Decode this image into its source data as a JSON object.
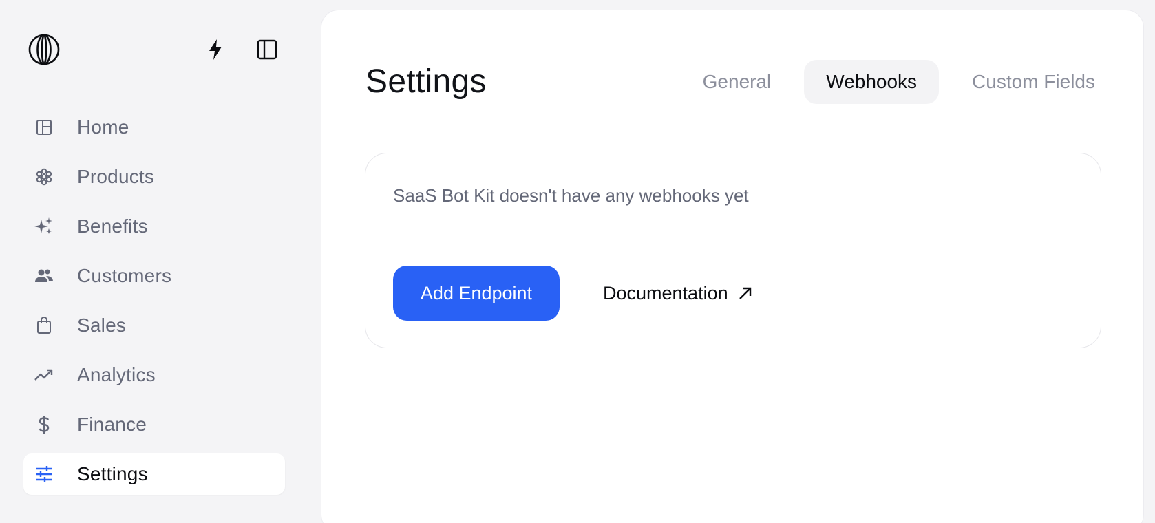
{
  "sidebar": {
    "logo_icon": "polar-logo-icon",
    "top_actions": [
      {
        "icon": "bolt-icon"
      },
      {
        "icon": "sidebar-panel-icon"
      }
    ],
    "items": [
      {
        "label": "Home",
        "icon": "layout-icon",
        "active": false
      },
      {
        "label": "Products",
        "icon": "hexagon-grid-icon",
        "active": false
      },
      {
        "label": "Benefits",
        "icon": "sparkles-icon",
        "active": false
      },
      {
        "label": "Customers",
        "icon": "people-icon",
        "active": false
      },
      {
        "label": "Sales",
        "icon": "shopping-bag-icon",
        "active": false
      },
      {
        "label": "Analytics",
        "icon": "trending-up-icon",
        "active": false
      },
      {
        "label": "Finance",
        "icon": "dollar-icon",
        "active": false
      },
      {
        "label": "Settings",
        "icon": "sliders-icon",
        "active": true
      }
    ]
  },
  "main": {
    "title": "Settings",
    "tabs": [
      {
        "label": "General",
        "active": false
      },
      {
        "label": "Webhooks",
        "active": true
      },
      {
        "label": "Custom Fields",
        "active": false
      }
    ],
    "webhooks": {
      "empty_message": "SaaS Bot Kit doesn't have any webhooks yet",
      "add_button_label": "Add Endpoint",
      "docs_link_label": "Documentation",
      "docs_link_icon": "arrow-up-right-icon"
    }
  },
  "colors": {
    "accent": "#2961f5",
    "background": "#f4f4f6",
    "card": "#ffffff",
    "muted_text": "#646878"
  }
}
